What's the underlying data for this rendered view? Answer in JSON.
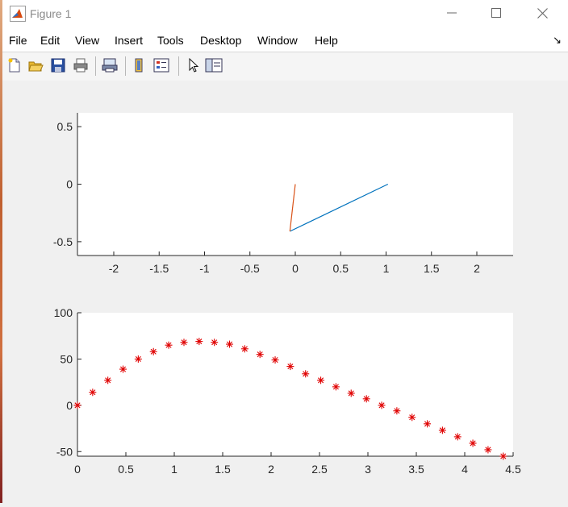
{
  "window": {
    "title": "Figure 1"
  },
  "menu": {
    "items": [
      "File",
      "Edit",
      "View",
      "Insert",
      "Tools",
      "Desktop",
      "Window",
      "Help"
    ]
  },
  "toolbar": {
    "icons": [
      "new-figure-icon",
      "open-file-icon",
      "save-icon",
      "print-icon",
      "print-preview-icon",
      "link-plot-icon",
      "insert-legend-icon",
      "edit-plot-arrow-icon",
      "property-inspector-icon"
    ]
  },
  "colors": {
    "line_blue": "#0072BD",
    "line_orange": "#D95319",
    "marker_red": "#E00000"
  },
  "chart_data": [
    {
      "type": "line",
      "xlim": [
        -2.4,
        2.4
      ],
      "ylim": [
        -0.62,
        0.62
      ],
      "xticks": [
        "-2",
        "-1.5",
        "-1",
        "-0.5",
        "0",
        "0.5",
        "1",
        "1.5",
        "2"
      ],
      "yticks": [
        "-0.5",
        "0",
        "0.5"
      ],
      "series": [
        {
          "color": "#0072BD",
          "x": [
            -0.06,
            1.02
          ],
          "y": [
            -0.41,
            0
          ]
        },
        {
          "color": "#D95319",
          "x": [
            -0.06,
            0
          ],
          "y": [
            -0.41,
            0
          ]
        }
      ],
      "grid": false
    },
    {
      "type": "scatter",
      "marker": "*",
      "xlim": [
        0,
        4.5
      ],
      "ylim": [
        -55,
        100
      ],
      "xticks": [
        "0",
        "0.5",
        "1",
        "1.5",
        "2",
        "2.5",
        "3",
        "3.5",
        "4",
        "4.5"
      ],
      "yticks": [
        "-50",
        "0",
        "50",
        "100"
      ],
      "x": [
        0,
        0.157,
        0.314,
        0.471,
        0.628,
        0.785,
        0.942,
        1.1,
        1.257,
        1.414,
        1.571,
        1.728,
        1.885,
        2.042,
        2.199,
        2.356,
        2.513,
        2.67,
        2.827,
        2.985,
        3.142,
        3.299,
        3.456,
        3.613,
        3.77,
        3.927,
        4.084,
        4.241,
        4.398
      ],
      "y": [
        0,
        14,
        27,
        39,
        50,
        58,
        65,
        68,
        69,
        68,
        66,
        61,
        55,
        49,
        42,
        34,
        27,
        20,
        13,
        7,
        0,
        -6,
        -13,
        -20,
        -27,
        -34,
        -41,
        -48,
        -55
      ],
      "grid": false
    }
  ]
}
